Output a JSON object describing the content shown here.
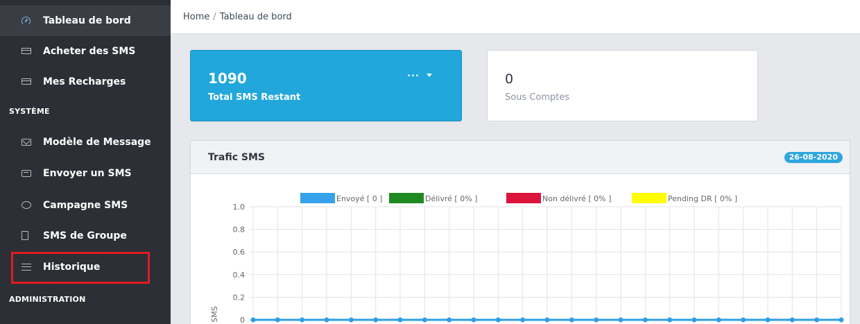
{
  "sidebar": {
    "items": [
      {
        "label": "Tableau de bord",
        "icon": "gauge-icon",
        "active": true
      },
      {
        "label": "Acheter des SMS",
        "icon": "credit-card-icon"
      },
      {
        "label": "Mes Recharges",
        "icon": "credit-card-icon"
      },
      {
        "label": "Modèle de Message",
        "icon": "envelope-icon"
      },
      {
        "label": "Envoyer un SMS",
        "icon": "message-icon"
      },
      {
        "label": "Campagne SMS",
        "icon": "chat-bubble-icon"
      },
      {
        "label": "SMS de Groupe",
        "icon": "rectangle-icon"
      },
      {
        "label": "Historique",
        "icon": "list-icon",
        "highlighted": true
      }
    ],
    "sections": {
      "system": "SYSTÈME",
      "administration": "ADMINISTRATION"
    }
  },
  "breadcrumb": {
    "home": "Home",
    "separator": "/",
    "current": "Tableau de bord"
  },
  "stats": {
    "sms_remaining": {
      "value": "1090",
      "label": "Total SMS Restant",
      "menu": "..."
    },
    "sub_accounts": {
      "value": "0",
      "label": "Sous Comptes"
    }
  },
  "panel": {
    "title": "Trafic SMS",
    "date": "26-08-2020"
  },
  "colors": {
    "sidebar_bg": "#2c2f35",
    "primary_card": "#21a7dc",
    "highlight": "#e21b22",
    "line": "#2f9ee6"
  },
  "chart_data": {
    "type": "line",
    "legend": [
      {
        "name": "Envoyé [ 0 ]",
        "color": "#36a2eb"
      },
      {
        "name": "Délivré [ 0% ]",
        "color": "#1f8a1f"
      },
      {
        "name": "Non délivré [ 0% ]",
        "color": "#dc143c"
      },
      {
        "name": "Pending DR [ 0% ]",
        "color": "#ffff00"
      }
    ],
    "ylabel": "SMS",
    "yticks": [
      "1.0",
      "0.8",
      "0.6",
      "0.4",
      "0.2",
      "0"
    ],
    "ylim": [
      0,
      1
    ],
    "series": [
      {
        "name": "Envoyé [ 0 ]",
        "values": [
          0,
          0,
          0,
          0,
          0,
          0,
          0,
          0,
          0,
          0,
          0,
          0,
          0,
          0,
          0,
          0,
          0,
          0,
          0,
          0,
          0,
          0,
          0,
          0,
          0
        ]
      }
    ],
    "grid": true,
    "legend_position": "top"
  }
}
